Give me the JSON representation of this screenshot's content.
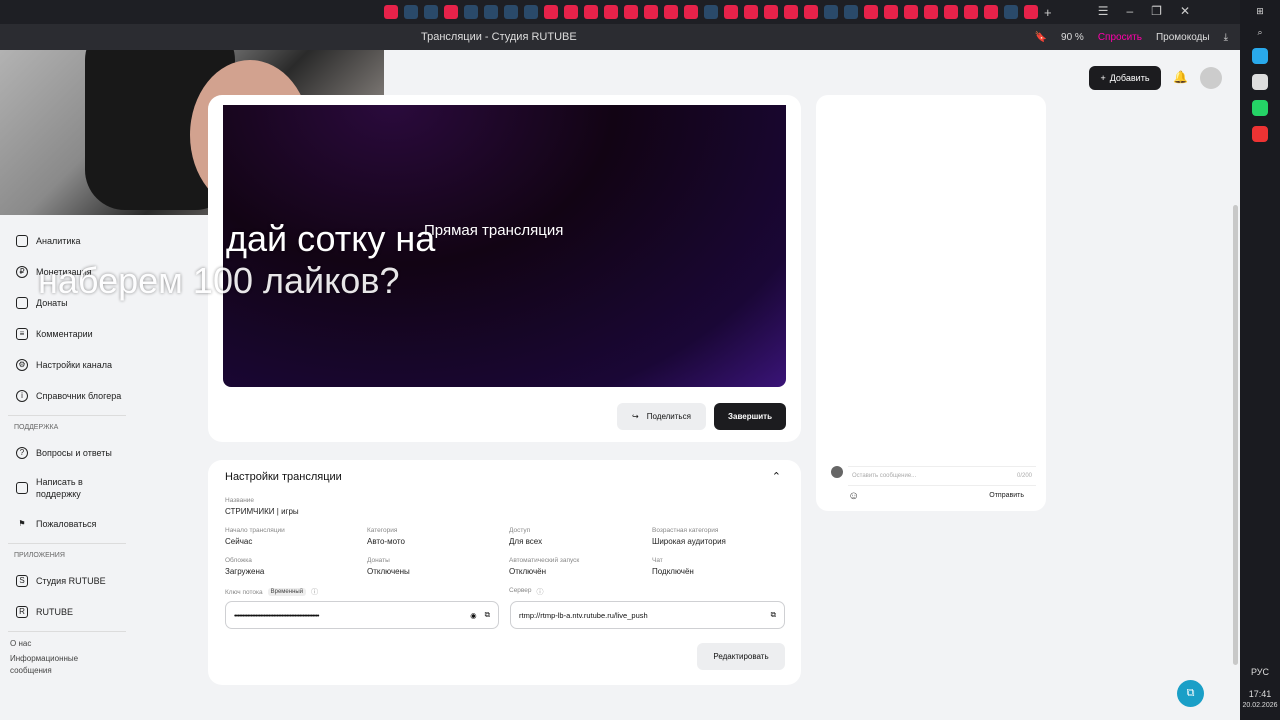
{
  "browser": {
    "tab_title": "Трансляции - Студия RUTUBE",
    "zoom": "90 %",
    "ask": "Спросить",
    "promo": "Промокоды"
  },
  "header": {
    "add_label": "Добавить"
  },
  "overlay": {
    "line1": "дай сотку на",
    "line2": "наберем 100 лайков?"
  },
  "sidebar": {
    "items": [
      {
        "label": "Аналитика",
        "icon": "chart-icon"
      },
      {
        "label": "Монетизация",
        "icon": "ruble-icon"
      },
      {
        "label": "Донаты",
        "icon": "wallet-icon"
      },
      {
        "label": "Комментарии",
        "icon": "comment-icon"
      },
      {
        "label": "Настройки канала",
        "icon": "gear-icon"
      },
      {
        "label": "Справочник блогера",
        "icon": "info-icon"
      }
    ],
    "support_heading": "ПОДДЕРЖКА",
    "support": [
      {
        "label": "Вопросы и ответы"
      },
      {
        "label": "Написать в поддержку"
      },
      {
        "label": "Пожаловаться"
      }
    ],
    "apps_heading": "ПРИЛОЖЕНИЯ",
    "apps": [
      {
        "label": "Студия RUTUBE"
      },
      {
        "label": "RUTUBE"
      }
    ],
    "footer": [
      "О нас",
      "Информационные сообщения"
    ]
  },
  "player": {
    "label": "Прямая трансляция"
  },
  "actions": {
    "share": "Поделиться",
    "finish": "Завершить"
  },
  "settings": {
    "title": "Настройки трансляции",
    "name_label": "Название",
    "name": "СТРИМЧИКИ | игры",
    "fields": [
      {
        "k": "Начало трансляции",
        "v": "Сейчас"
      },
      {
        "k": "Категория",
        "v": "Авто-мото"
      },
      {
        "k": "Доступ",
        "v": "Для всех"
      },
      {
        "k": "Возрастная категория",
        "v": "Широкая аудитория"
      },
      {
        "k": "Обложка",
        "v": "Загружена"
      },
      {
        "k": "Донаты",
        "v": "Отключены"
      },
      {
        "k": "Автоматический запуск",
        "v": "Отключён"
      },
      {
        "k": "Чат",
        "v": "Подключён"
      }
    ],
    "key_label": "Ключ потока",
    "key_badge": "Временный",
    "key_value": "••••••••••••••••••••••••••••••••••••••••••••••••••••",
    "server_label": "Сервер",
    "server_value": "rtmp://rtmp-lb-a.ntv.rutube.ru/live_push",
    "edit": "Редактировать"
  },
  "chat": {
    "placeholder": "Оставить сообщение...",
    "counter": "0/200",
    "send": "Отправить"
  },
  "taskbar": {
    "lang": "РУС",
    "time": "17:41",
    "date": "20.02.2026"
  }
}
